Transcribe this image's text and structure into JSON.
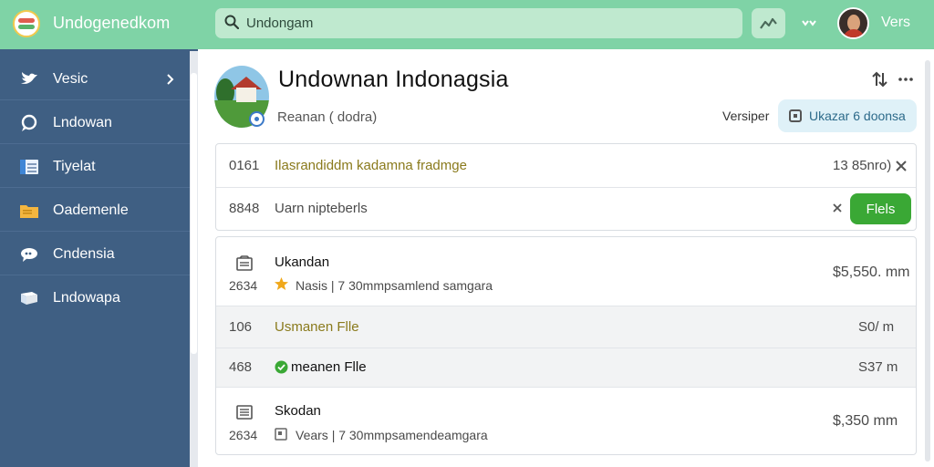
{
  "topbar": {
    "app_title": "Undogenedkom",
    "search_value": "Undongam",
    "user_label": "Vers"
  },
  "sidebar": {
    "items": [
      {
        "label": "Vesic",
        "icon": "bird-icon",
        "has_arrow": true
      },
      {
        "label": "Lndowan",
        "icon": "chat-bubble-icon"
      },
      {
        "label": "Tiyelat",
        "icon": "list-icon"
      },
      {
        "label": "Oademenle",
        "icon": "folder-icon"
      },
      {
        "label": "Cndensia",
        "icon": "cloud-chat-icon"
      },
      {
        "label": "Lndowapa",
        "icon": "flag-icon"
      }
    ]
  },
  "header": {
    "title": "Undownan Indonagsia",
    "subtitle": "Reanan ( dodra)",
    "version_label": "Versiper",
    "version_pill": "Ukazar 6 doonsa"
  },
  "card1": {
    "rows": [
      {
        "id": "0161",
        "text": "Ilasrandiddm kadamna fradmge",
        "value": "13 85nro)"
      },
      {
        "id": "8848",
        "text": "Uarn nipteberls",
        "button": "Flels"
      }
    ]
  },
  "card2": {
    "rows": [
      {
        "type": "doc",
        "title": "Ukandan",
        "year": "2634",
        "meta": "Nasis | 7 30mmpsamlend samgara",
        "price": "$5,550. mm"
      },
      {
        "type": "file",
        "id": "106",
        "title": "Usmanen Flle",
        "price": "S0/ m"
      },
      {
        "type": "file",
        "id": "468",
        "title": "meanen Flle",
        "price": "S37 m"
      },
      {
        "type": "doc",
        "title": "Skodan",
        "year": "2634",
        "meta": "Vears | 7 30mmpsamendeamgara",
        "price": "$,350 mm"
      }
    ]
  },
  "colors": {
    "topbar": "#7fd3a6",
    "sidebar": "#3f5f83",
    "accent_green": "#3aa835",
    "link_olive": "#8a7a1c",
    "pill": "#dff1f8"
  }
}
